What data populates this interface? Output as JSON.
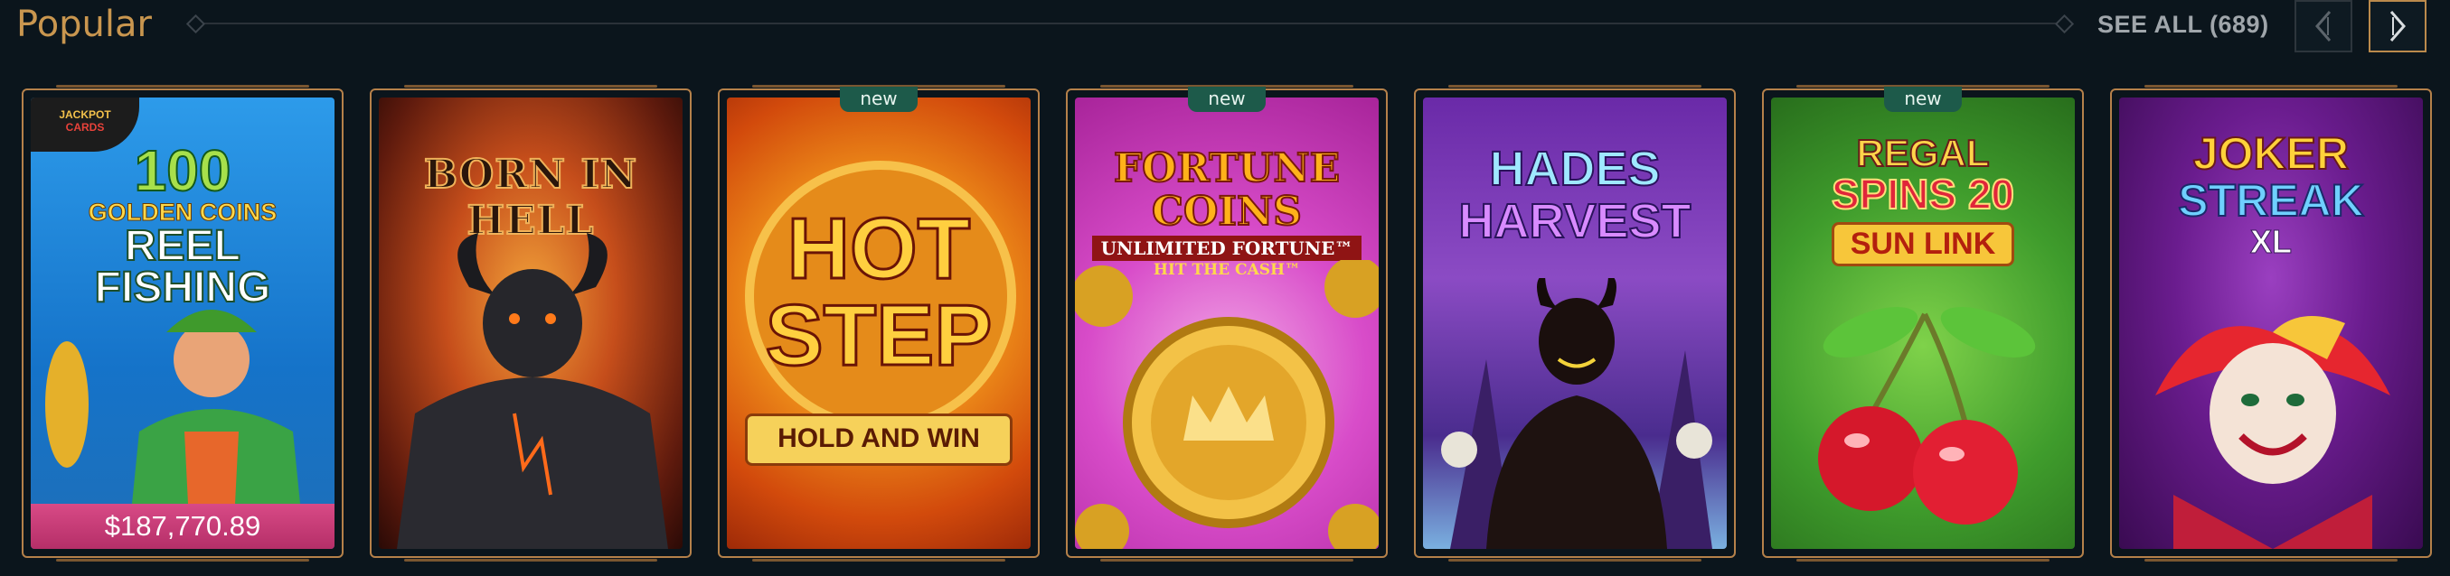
{
  "section": {
    "title": "Popular",
    "see_all_label": "SEE ALL (689)"
  },
  "navigation": {
    "prev_icon": "chevron-left-icon",
    "next_icon": "chevron-right-icon"
  },
  "colors": {
    "accent_gold": "#c9964f",
    "background": "#0b151c",
    "new_badge": "#1d5a4a",
    "jackpot_pink": "#d84a86"
  },
  "games": [
    {
      "title_lines": [
        "100",
        "GOLDEN COINS",
        "REEL",
        "FISHING"
      ],
      "tag_lines": [
        "JACKPOT",
        "CARDS"
      ],
      "jackpot": "$187,770.89",
      "badge": ""
    },
    {
      "title_lines": [
        "BORN IN HELL"
      ],
      "badge": ""
    },
    {
      "title_lines": [
        "HOT",
        "STEP",
        "HOLD AND WIN"
      ],
      "badge": "new"
    },
    {
      "title_lines": [
        "FORTUNE COINS",
        "UNLIMITED FORTUNE™",
        "HIT THE CASH™"
      ],
      "badge": "new"
    },
    {
      "title_lines": [
        "HADES",
        "HARVEST"
      ],
      "badge": ""
    },
    {
      "title_lines": [
        "REGAL",
        "SPINS 20",
        "SUN LINK"
      ],
      "badge": "new"
    },
    {
      "title_lines": [
        "JOKER",
        "STREAK",
        "XL"
      ],
      "badge": ""
    }
  ]
}
